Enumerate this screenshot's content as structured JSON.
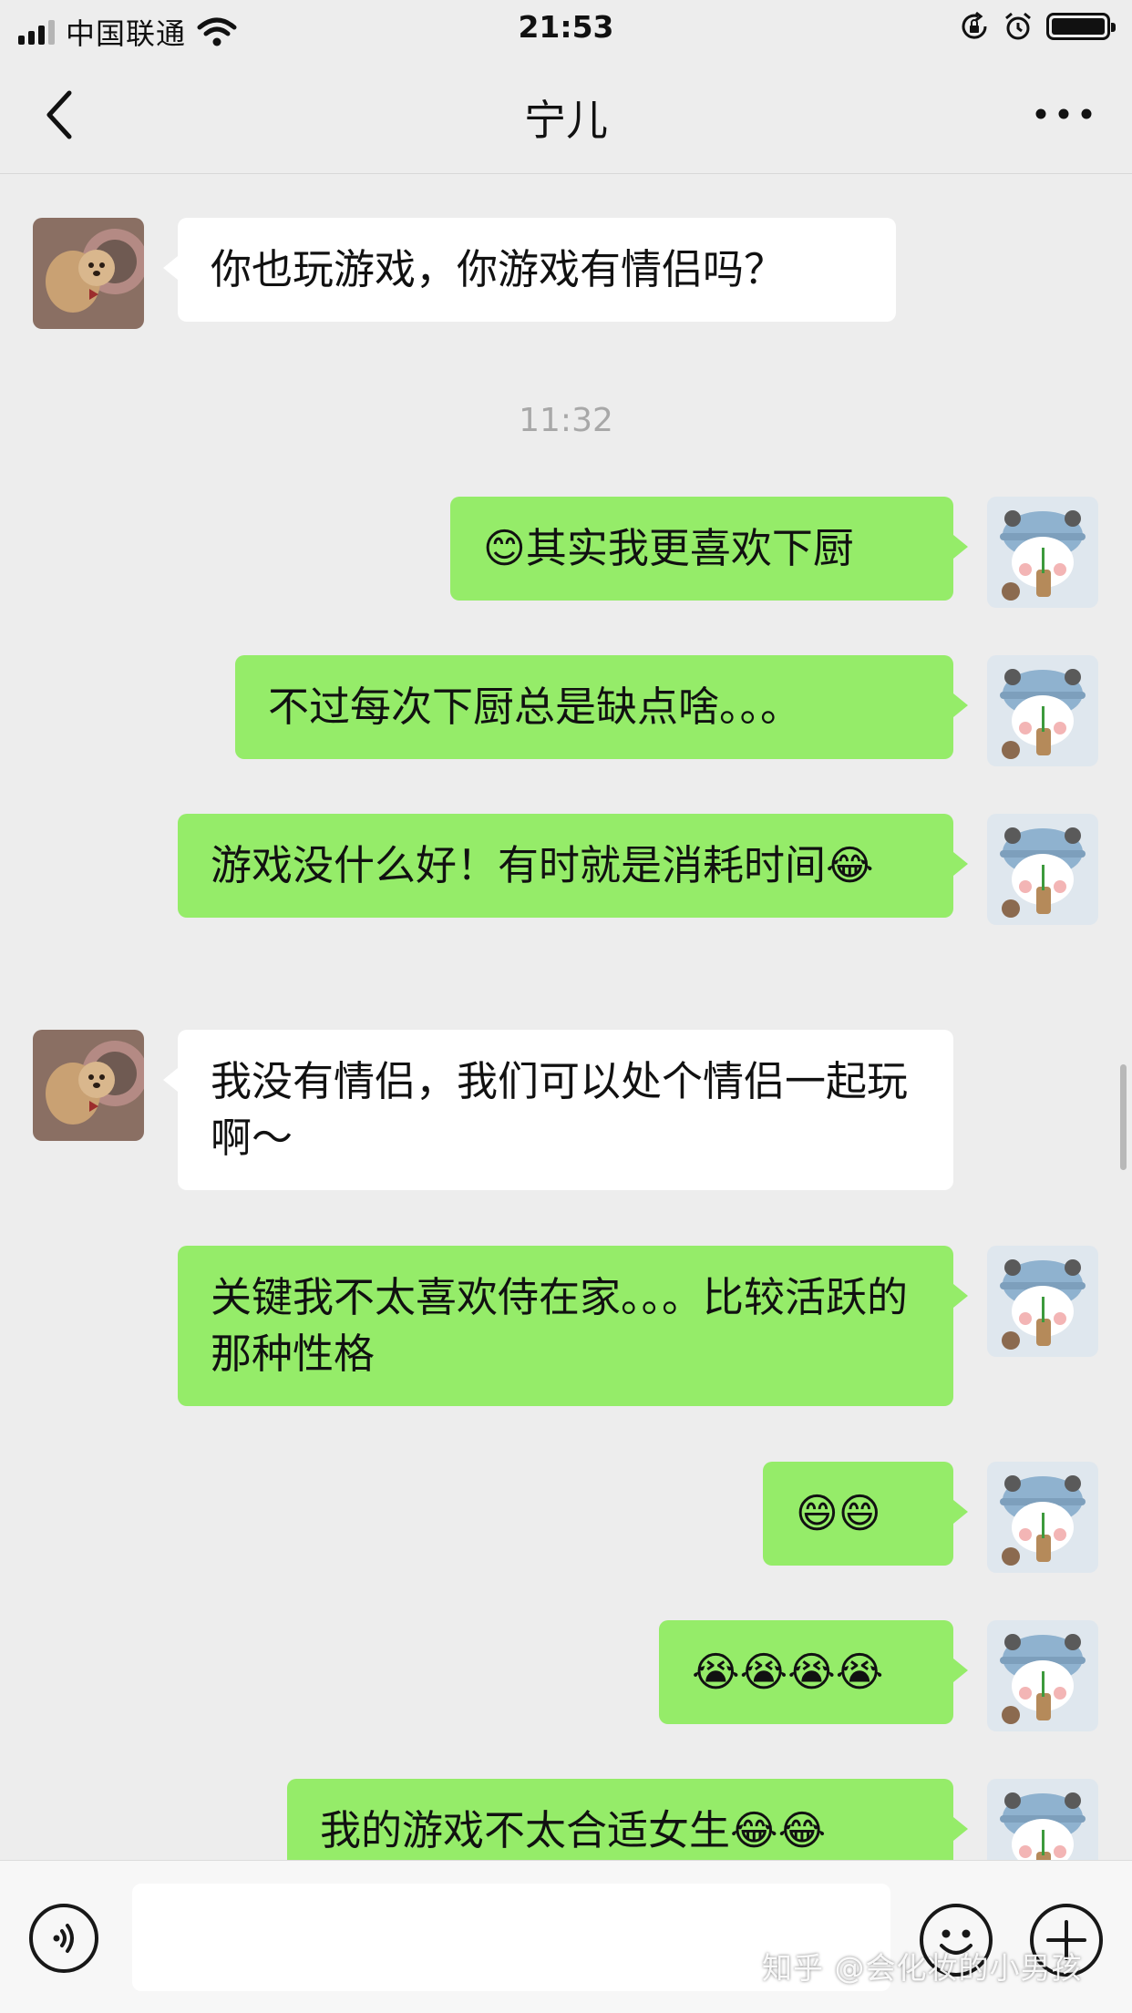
{
  "status_bar": {
    "carrier": "中国联通",
    "time": "21:53",
    "icons": [
      "signal-icon",
      "wifi-icon",
      "orientation-lock-icon",
      "alarm-icon",
      "battery-icon"
    ]
  },
  "header": {
    "title": "宁儿",
    "back_icon": "chevron-left-icon",
    "more_icon": "more-dots-icon"
  },
  "messages": [
    {
      "from": "contact",
      "text": "你也玩游戏，你游戏有情侣吗？"
    },
    {
      "timestamp": "11:32"
    },
    {
      "from": "me",
      "text": "😊其实我更喜欢下厨"
    },
    {
      "from": "me",
      "text": "不过每次下厨总是缺点啥。。。"
    },
    {
      "from": "me",
      "text": "游戏没什么好！有时就是消耗时间😂"
    },
    {
      "from": "contact",
      "text": "我没有情侣，我们可以处个情侣一起玩啊～"
    },
    {
      "from": "me",
      "text": "关键我不太喜欢侍在家。。。比较活跃的那种性格"
    },
    {
      "from": "me",
      "text": "😄😄"
    },
    {
      "from": "me",
      "text": "😭😭😭😭"
    },
    {
      "from": "me",
      "text": "我的游戏不太合适女生😂😂"
    }
  ],
  "colors": {
    "background": "#ededed",
    "outgoing_bubble": "#95ec69",
    "incoming_bubble": "#ffffff",
    "timestamp": "#a8a8a8"
  },
  "input_bar": {
    "text_value": "",
    "icons": [
      "voice-icon",
      "emoji-icon",
      "plus-icon"
    ]
  },
  "watermark": "知乎 @会化妆的小男孩"
}
